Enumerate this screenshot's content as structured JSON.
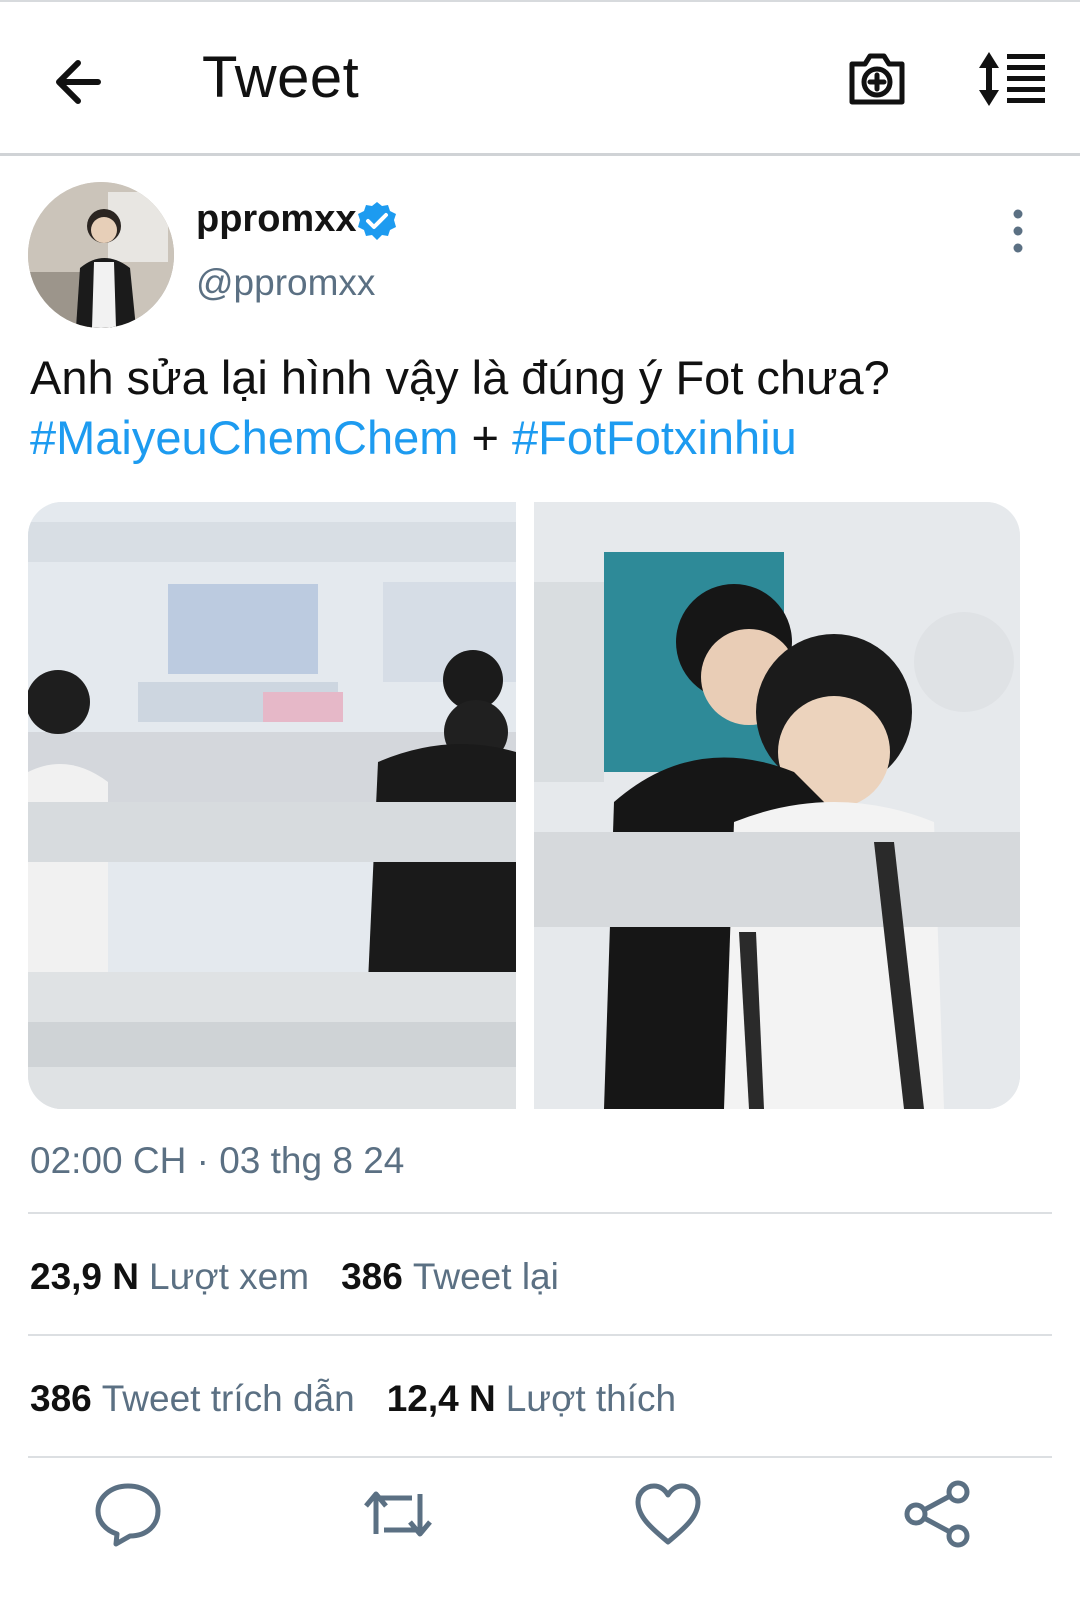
{
  "header": {
    "title": "Tweet",
    "icons": {
      "back": "arrow-left-icon",
      "camera": "camera-plus-icon",
      "sort": "sort-list-icon"
    }
  },
  "author": {
    "display_name": "ppromxx",
    "handle": "@ppromxx",
    "verified": true,
    "verified_color": "#1d9bf0"
  },
  "tweet": {
    "text": "Anh sửa lại hình vậy là đúng ý Fot chưa?",
    "hashtag_1": "#MaiyeuChemChem",
    "separator": "+",
    "hashtag_2": "#FotFotxinhiu",
    "images": [
      "photo-1",
      "photo-2"
    ],
    "timestamp": "02:00 CH · 03 thg 8 24"
  },
  "stats": {
    "views_count": "23,9 N",
    "views_label": "Lượt xem",
    "retweets_count": "386",
    "retweets_label": "Tweet lại",
    "quotes_count": "386",
    "quotes_label": "Tweet trích dẫn",
    "likes_count": "12,4 N",
    "likes_label": "Lượt thích"
  },
  "actions": [
    "reply-icon",
    "retweet-icon",
    "like-icon",
    "share-icon"
  ],
  "colors": {
    "accent": "#1d9bf0",
    "secondary_text": "#5b7083",
    "divider": "#dcdfe2"
  }
}
